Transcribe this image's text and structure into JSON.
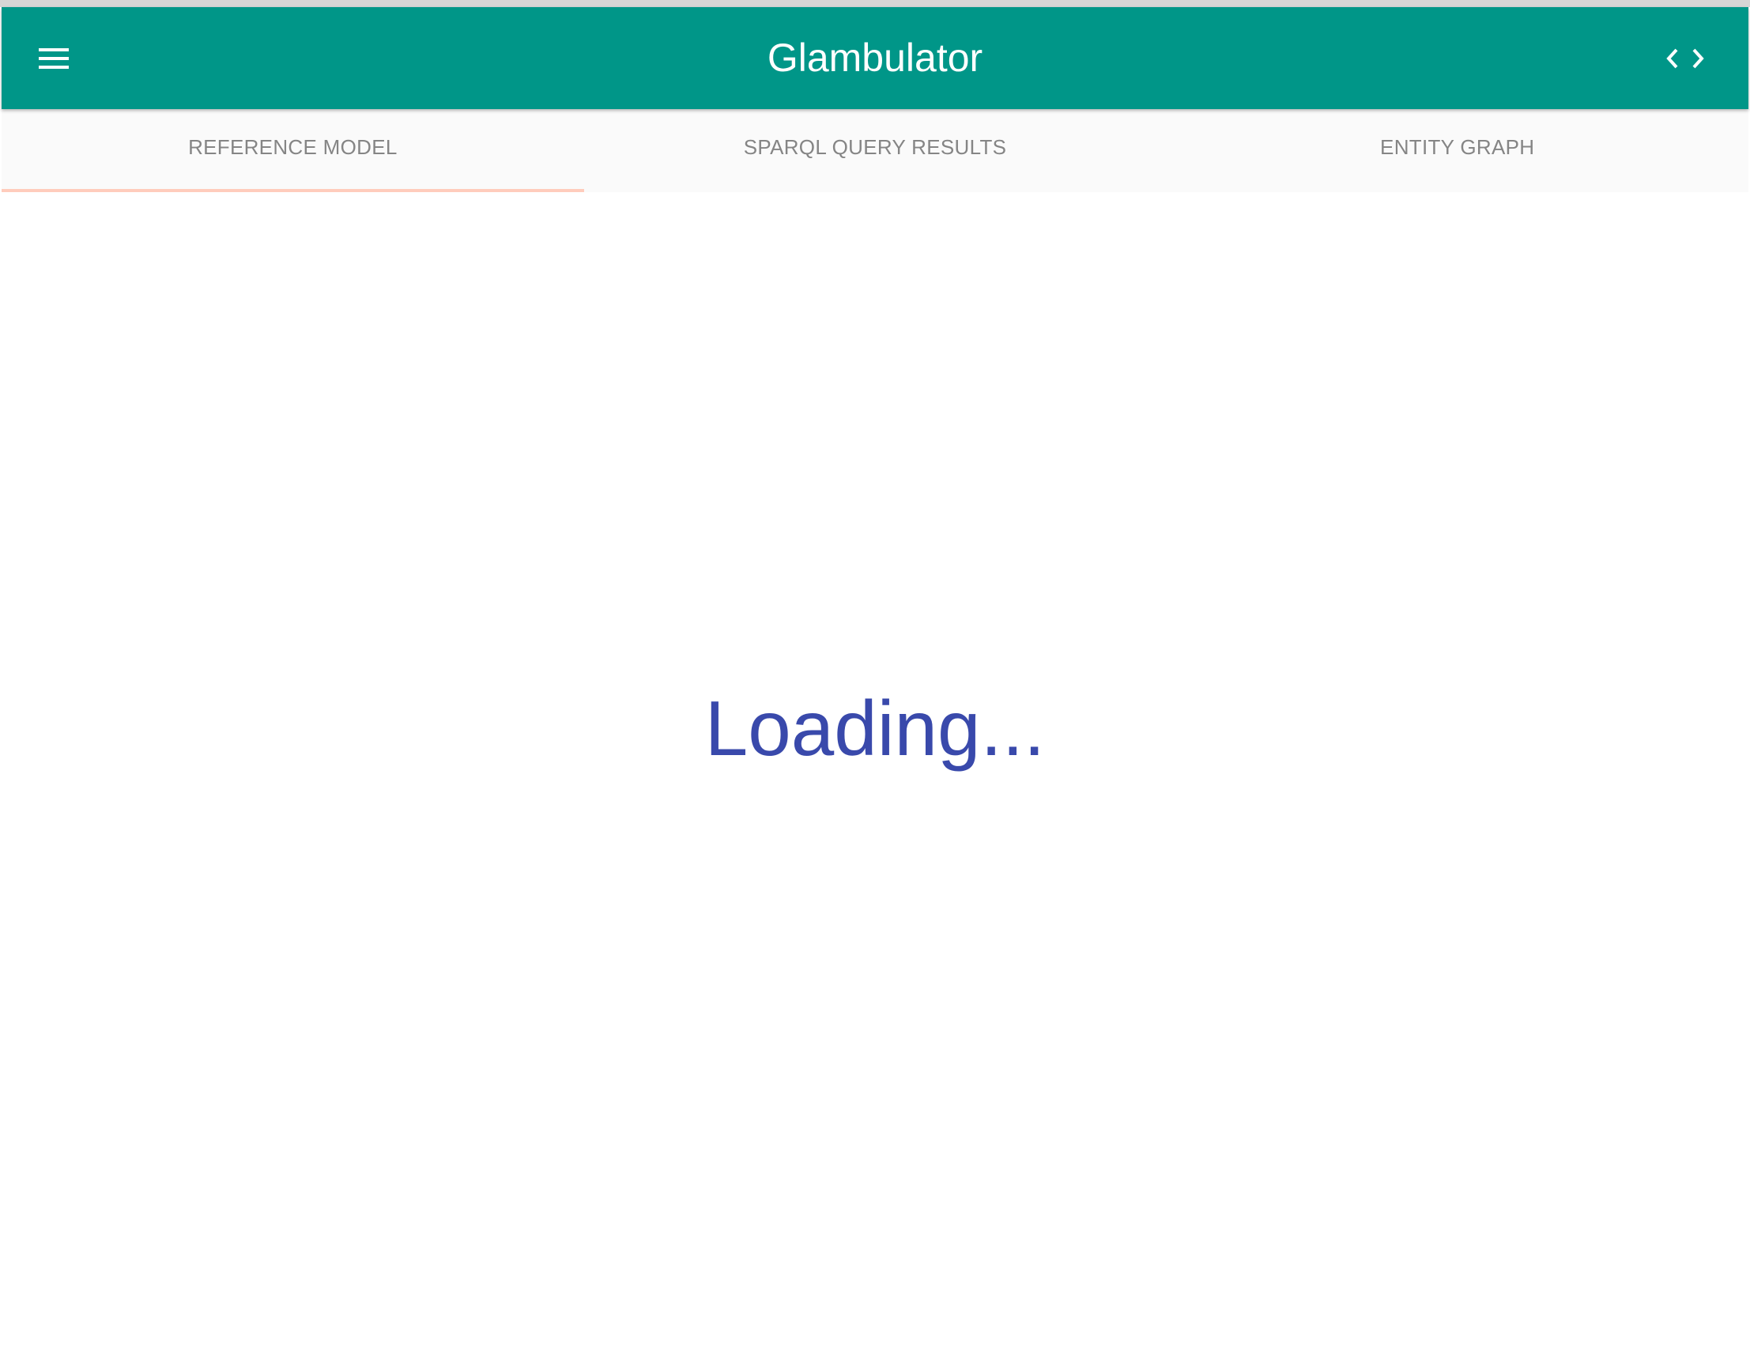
{
  "app": {
    "title": "Glambulator"
  },
  "toolbar": {
    "menu_icon": "menu-icon",
    "code_icon": "code-icon"
  },
  "tabs": [
    {
      "label": "REFERENCE MODEL",
      "active": true
    },
    {
      "label": "SPARQL QUERY RESULTS",
      "active": false
    },
    {
      "label": "ENTITY GRAPH",
      "active": false
    }
  ],
  "content": {
    "status_text": "Loading..."
  },
  "colors": {
    "primary": "#009688",
    "tab_indicator": "#ffccbc",
    "loading_text": "#3949ab",
    "tab_text": "#858585"
  }
}
